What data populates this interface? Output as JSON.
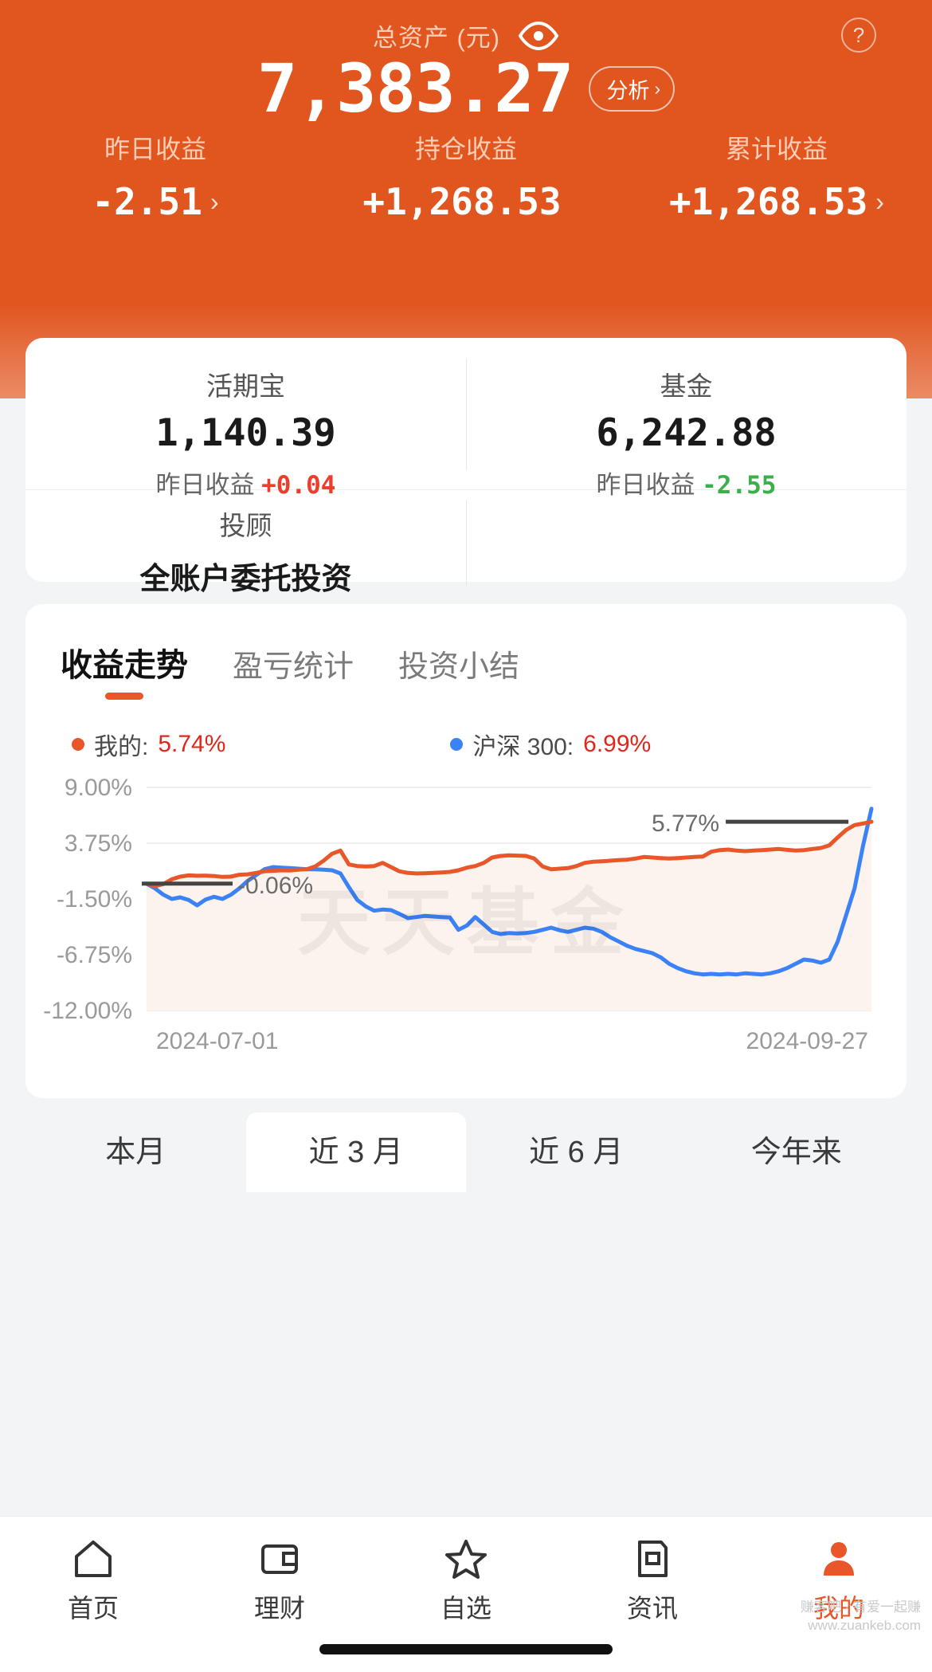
{
  "header": {
    "total_label": "总资产 (元)",
    "eye_icon": "eye-icon",
    "help_icon": "question-mark-icon",
    "total_amount": "7,383.27",
    "analyze_label": "分析",
    "chevron": "›",
    "stats": [
      {
        "label": "昨日收益",
        "value": "-2.51",
        "chevron": "›"
      },
      {
        "label": "持仓收益",
        "value": "+1,268.53",
        "chevron": ""
      },
      {
        "label": "累计收益",
        "value": "+1,268.53",
        "chevron": "›"
      }
    ],
    "bg_color": "#e1551f"
  },
  "asset_card": {
    "columns": [
      {
        "name": "活期宝",
        "amount": "1,140.39",
        "sub_label": "昨日收益",
        "sub_value": "+0.04",
        "sub_dir": "up"
      },
      {
        "name": "基金",
        "amount": "6,242.88",
        "sub_label": "昨日收益",
        "sub_value": "-2.55",
        "sub_dir": "down"
      }
    ],
    "advisor": {
      "title": "投顾",
      "value": "全账户委托投资"
    }
  },
  "chart_card": {
    "tabs": [
      {
        "label": "收益走势",
        "active": true
      },
      {
        "label": "盈亏统计",
        "active": false
      },
      {
        "label": "投资小结",
        "active": false
      }
    ],
    "watermark": "天天基金"
  },
  "chart_data": {
    "type": "line",
    "title": "收益走势",
    "xlabel": "",
    "ylabel": "",
    "ylim": [
      -12.0,
      9.0
    ],
    "yticks": [
      "9.00%",
      "3.75%",
      "-1.50%",
      "-6.75%",
      "-12.00%"
    ],
    "ytick_values": [
      9.0,
      3.75,
      -1.5,
      -6.75,
      -12.0
    ],
    "xticks": [
      "2024-07-01",
      "2024-09-27"
    ],
    "grid": true,
    "legend_position": "top",
    "annotations": [
      {
        "text": "-0.06%",
        "series": "我的",
        "x_index": 0,
        "value": -0.06
      },
      {
        "text": "5.77%",
        "series": "我的",
        "x_index": 81,
        "value": 5.77
      }
    ],
    "series": [
      {
        "name": "我的",
        "legend_label": "我的:",
        "legend_value": "5.74%",
        "color": "#e8562a",
        "final_value": 5.74,
        "values": [
          -0.06,
          -0.3,
          -0.1,
          0.35,
          0.6,
          0.72,
          0.68,
          0.7,
          0.66,
          0.58,
          0.6,
          0.78,
          0.82,
          0.95,
          1.1,
          1.15,
          1.2,
          1.18,
          1.25,
          1.3,
          1.55,
          2.1,
          2.75,
          3.05,
          1.75,
          1.6,
          1.55,
          1.6,
          1.9,
          1.5,
          1.1,
          0.95,
          0.9,
          0.92,
          0.95,
          1.0,
          1.05,
          1.2,
          1.45,
          1.6,
          1.9,
          2.4,
          2.55,
          2.6,
          2.58,
          2.55,
          2.3,
          1.55,
          1.3,
          1.35,
          1.4,
          1.6,
          1.9,
          2.0,
          2.05,
          2.1,
          2.15,
          2.2,
          2.3,
          2.45,
          2.4,
          2.35,
          2.3,
          2.35,
          2.4,
          2.45,
          2.5,
          2.95,
          3.1,
          3.15,
          3.05,
          3.0,
          3.05,
          3.1,
          3.15,
          3.2,
          3.12,
          3.05,
          3.1,
          3.2,
          3.3,
          3.55,
          4.3,
          5.0,
          5.45,
          5.6,
          5.77
        ]
      },
      {
        "name": "沪深300",
        "legend_label": "沪深 300:",
        "legend_value": "6.99%",
        "color": "#3b82f6",
        "final_value": 6.99,
        "values": [
          -0.06,
          -0.5,
          -1.1,
          -1.5,
          -1.35,
          -1.6,
          -2.1,
          -1.55,
          -1.3,
          -1.5,
          -1.1,
          -0.5,
          0.2,
          0.75,
          1.3,
          1.5,
          1.45,
          1.4,
          1.35,
          1.3,
          1.3,
          1.25,
          1.2,
          0.9,
          -0.4,
          -1.6,
          -2.2,
          -2.6,
          -2.5,
          -2.55,
          -2.9,
          -3.3,
          -3.2,
          -3.1,
          -3.15,
          -3.2,
          -3.25,
          -4.4,
          -4.0,
          -3.2,
          -3.9,
          -4.6,
          -4.8,
          -4.7,
          -4.75,
          -4.7,
          -4.6,
          -4.4,
          -4.2,
          -4.45,
          -4.6,
          -4.4,
          -4.2,
          -4.3,
          -4.6,
          -5.1,
          -5.5,
          -5.9,
          -6.2,
          -6.4,
          -6.6,
          -7.0,
          -7.6,
          -8.0,
          -8.3,
          -8.5,
          -8.6,
          -8.55,
          -8.6,
          -8.55,
          -8.6,
          -8.5,
          -8.55,
          -8.6,
          -8.5,
          -8.3,
          -8.0,
          -7.6,
          -7.2,
          -7.3,
          -7.5,
          -7.2,
          -5.5,
          -3.0,
          -0.5,
          3.5,
          6.99
        ]
      }
    ]
  },
  "periods": [
    {
      "label": "本月",
      "active": false
    },
    {
      "label": "近 3 月",
      "active": true
    },
    {
      "label": "近 6 月",
      "active": false
    },
    {
      "label": "今年来",
      "active": false
    }
  ],
  "navbar": {
    "items": [
      {
        "label": "首页",
        "icon": "home-icon",
        "active": false
      },
      {
        "label": "理财",
        "icon": "wallet-icon",
        "active": false
      },
      {
        "label": "自选",
        "icon": "star-icon",
        "active": false
      },
      {
        "label": "资讯",
        "icon": "news-icon",
        "active": false
      },
      {
        "label": "我的",
        "icon": "person-icon",
        "active": true
      }
    ],
    "active_color": "#e8562a"
  },
  "watermark_corner": "赚客吧 · 有爱一起赚\nwww.zuankeb.com"
}
